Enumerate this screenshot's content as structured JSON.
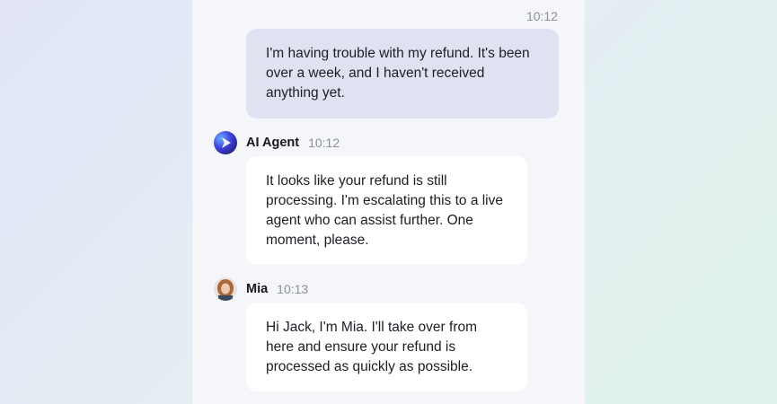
{
  "chat": {
    "user_message": {
      "time": "10:12",
      "text": "I'm having trouble with my refund. It's been over a week, and I haven't received anything yet."
    },
    "ai_message": {
      "sender": "AI Agent",
      "time": "10:12",
      "avatar_icon": "ai-agent-logo-icon",
      "text": "It looks like your refund is still processing. I'm escalating this to a live agent who can assist further. One moment, please."
    },
    "mia_message": {
      "sender": "Mia",
      "time": "10:13",
      "avatar_icon": "mia-avatar-photo",
      "text": "Hi Jack, I'm Mia. I'll take over from here and ensure your refund is processed as quickly as possible."
    }
  },
  "colors": {
    "user_bubble": "#dfe2f1",
    "agent_bubble": "#ffffff",
    "panel": "#f5f6fa"
  }
}
